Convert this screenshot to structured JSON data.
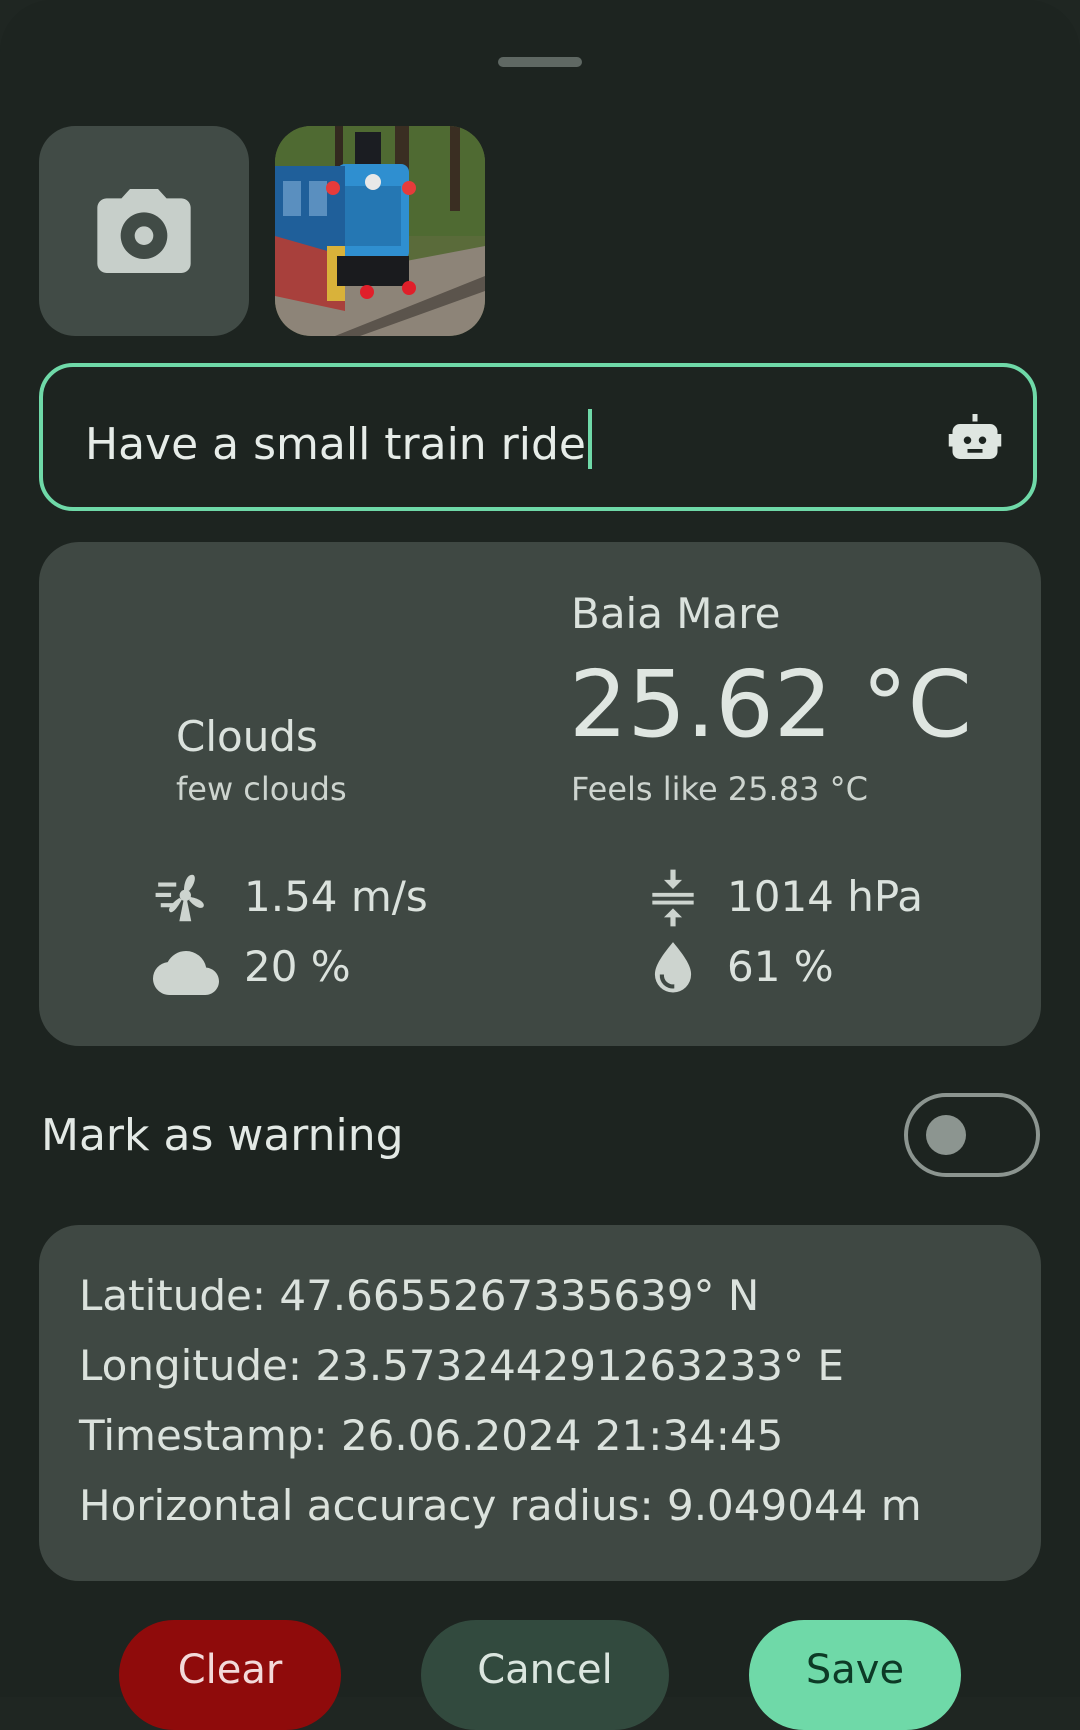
{
  "images": {
    "camera_icon": "camera-icon",
    "photo_alt": "photo of a small blue train"
  },
  "note_field": {
    "value": "Have a small train ride",
    "icon": "robot-icon"
  },
  "weather": {
    "main": "Clouds",
    "description": "few clouds",
    "city": "Baia Mare",
    "temperature": "25.62 °C",
    "feels_like": "Feels like 25.83 °C",
    "wind": "1.54 m/s",
    "pressure": "1014 hPa",
    "cloudiness": "20 %",
    "humidity": "61 %"
  },
  "warning": {
    "label": "Mark as warning",
    "enabled": false
  },
  "location": {
    "latitude": "Latitude: 47.6655267335639° N",
    "longitude": "Longitude: 23.573244291263233° E",
    "timestamp": "Timestamp: 26.06.2024 21:34:45",
    "accuracy": "Horizontal accuracy radius: 9.049044 m"
  },
  "buttons": {
    "clear": "Clear",
    "cancel": "Cancel",
    "save": "Save"
  },
  "colors": {
    "accent": "#6fd9a8",
    "danger": "#8f0b0b",
    "surface": "#3f4843",
    "background": "#1d2420"
  }
}
